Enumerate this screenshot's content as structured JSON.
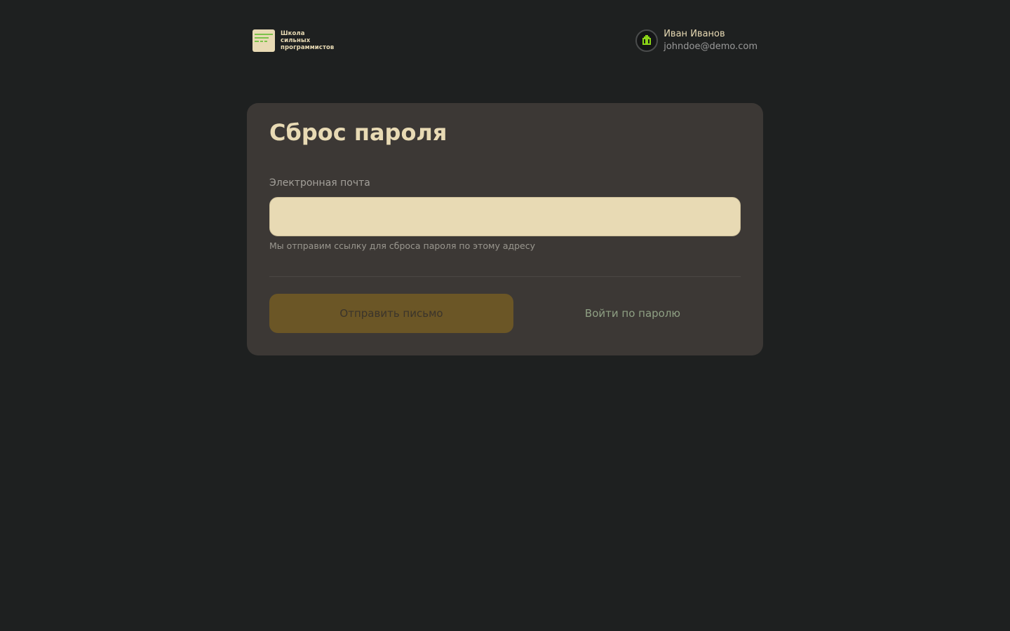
{
  "header": {
    "logo": {
      "lines": [
        "Школа",
        "сильных",
        "программистов"
      ]
    },
    "user": {
      "name": "Иван Иванов",
      "email": "johndoe@demo.com"
    }
  },
  "reset_form": {
    "title": "Сброс пароля",
    "email_label": "Электронная почта",
    "email_value": "",
    "email_placeholder": "",
    "hint": "Мы отправим ссылку для сброса пароля по этому адресу",
    "send_button_label": "Отправить письмо",
    "login_link_label": "Войти по паролю"
  },
  "colors": {
    "background": "#1e2020",
    "card": "#3c3835",
    "accent_text": "#e8dab4",
    "button_disabled": "#6b5626",
    "link": "#8fa084",
    "logo_green": "#7cc24a",
    "avatar_icon_green": "#8bd417"
  },
  "icons": {
    "logo": "school-logo-icon",
    "avatar": "pixel-house-avatar-icon"
  },
  "state": {
    "send_button_disabled": true
  }
}
